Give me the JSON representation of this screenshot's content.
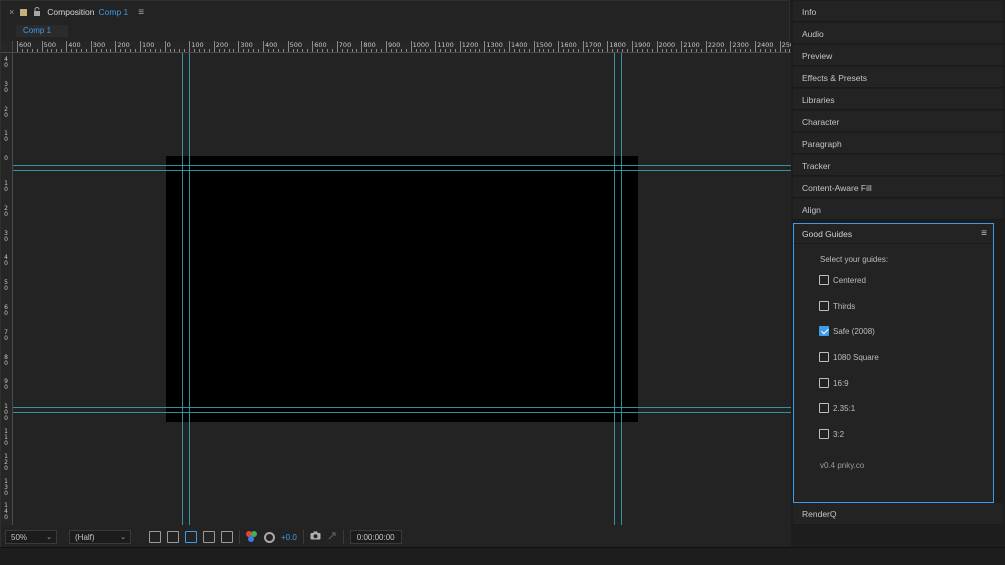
{
  "comp_panel": {
    "title": "Composition",
    "comp_name": "Comp 1",
    "tab_label": "Comp 1",
    "close_glyph": "×",
    "lock_glyph": "🔓",
    "menu_glyph": "≡"
  },
  "ruler": {
    "h_labels": [
      "600",
      "500",
      "400",
      "300",
      "200",
      "100",
      "0",
      "100",
      "200",
      "300",
      "400",
      "500",
      "600",
      "700",
      "800",
      "900",
      "1000",
      "1100",
      "1200",
      "1300",
      "1400",
      "1500",
      "1600",
      "1700",
      "1800",
      "1900",
      "2000",
      "2100",
      "2200",
      "2300",
      "2400",
      "2500"
    ],
    "v_labels": [
      "40",
      "30",
      "20",
      "10",
      "0",
      "10",
      "20",
      "30",
      "40",
      "50",
      "60",
      "70",
      "80",
      "90",
      "100",
      "110",
      "120",
      "130",
      "140"
    ]
  },
  "footer": {
    "zoom": "50%",
    "resolution": "(Half)",
    "exposure": "+0.0",
    "timecode": "0:00:00:00",
    "chevron": "⌄"
  },
  "right_panels": {
    "tabs": [
      "Info",
      "Audio",
      "Preview",
      "Effects & Presets",
      "Libraries",
      "Character",
      "Paragraph",
      "Tracker",
      "Content-Aware Fill",
      "Align"
    ],
    "renderq": "RenderQ"
  },
  "good_guides": {
    "title": "Good Guides",
    "menu_glyph": "≡",
    "prompt": "Select your guides:",
    "options": [
      {
        "label": "Centered",
        "checked": false
      },
      {
        "label": "Thirds",
        "checked": false
      },
      {
        "label": "Safe (2008)",
        "checked": true
      },
      {
        "label": "1080 Square",
        "checked": false
      },
      {
        "label": "16:9",
        "checked": false
      },
      {
        "label": "2.35:1",
        "checked": false
      },
      {
        "label": "3:2",
        "checked": false
      }
    ],
    "version": "v0.4 pnky.co"
  },
  "colors": {
    "accent": "#3d9be9",
    "guide": "#3aa8b8",
    "panel_bg": "#232323",
    "canvas": "#000000"
  }
}
